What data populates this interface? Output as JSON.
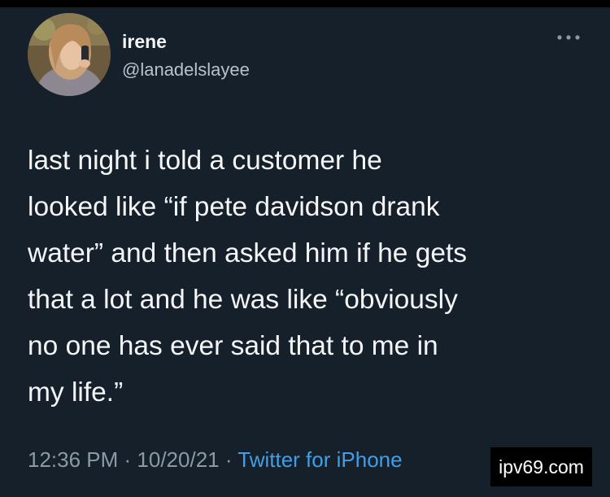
{
  "user": {
    "display_name": "irene",
    "handle": "@lanadelslayee"
  },
  "tweet": {
    "text": "last night i told a customer he\nlooked like “if pete davidson drank\nwater” and then asked him if he gets\nthat a lot and he was like “obviously\nno one has ever said that to me in\nmy life.”"
  },
  "meta": {
    "time": "12:36 PM",
    "separator": " · ",
    "date": "10/20/21",
    "source": "Twitter for iPhone"
  },
  "watermark": {
    "text": "ipv69.com"
  },
  "icons": {
    "more": "more-horizontal-icon"
  },
  "colors": {
    "background": "#15202b",
    "link": "#3f9fe8",
    "secondary_text": "#8d99a4"
  }
}
